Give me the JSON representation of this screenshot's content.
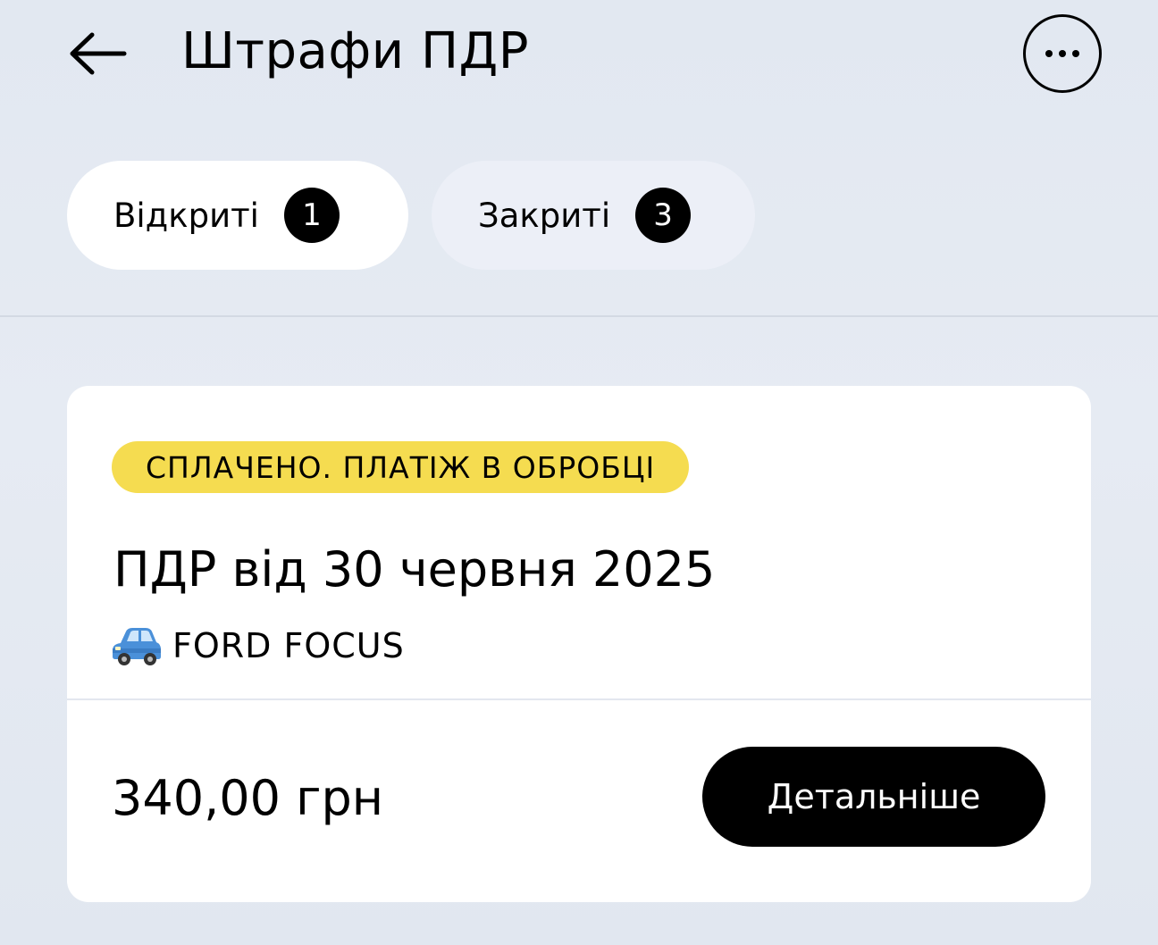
{
  "header": {
    "title": "Штрафи ПДР",
    "back_icon": "arrow-left-icon",
    "more_icon": "more-horizontal-icon"
  },
  "tabs": [
    {
      "label": "Відкриті",
      "count": "1",
      "active": true
    },
    {
      "label": "Закриті",
      "count": "3",
      "active": false
    }
  ],
  "fines": [
    {
      "status": "СПЛАЧЕНО. ПЛАТІЖ В ОБРОБЦІ",
      "status_color": "#f5dc50",
      "title": "ПДР від 30 червня 2025",
      "vehicle_icon": "car-icon",
      "vehicle": "FORD FOCUS",
      "amount": "340,00 грн",
      "details_label": "Детальніше"
    }
  ]
}
